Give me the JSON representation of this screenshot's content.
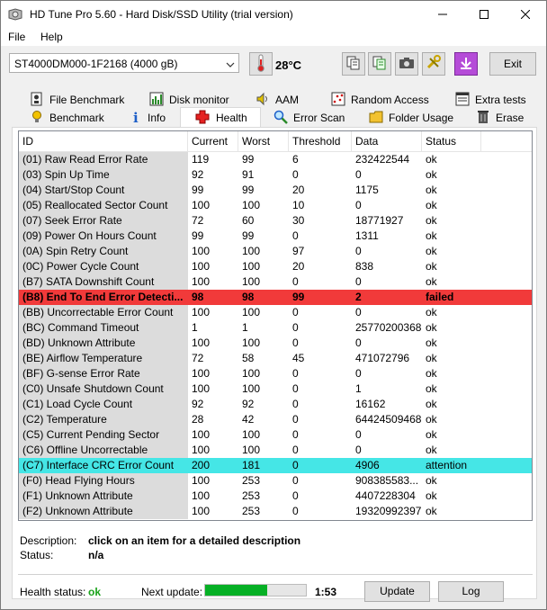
{
  "window": {
    "title": "HD Tune Pro 5.60 - Hard Disk/SSD Utility (trial version)"
  },
  "menu": {
    "file": "File",
    "help": "Help"
  },
  "toolbar": {
    "drive": "ST4000DM000-1F2168 (4000 gB)",
    "temperature": "28°C",
    "exit_label": "Exit"
  },
  "tabs_top": [
    {
      "label": "File Benchmark"
    },
    {
      "label": "Disk monitor"
    },
    {
      "label": "AAM"
    },
    {
      "label": "Random Access"
    },
    {
      "label": "Extra tests"
    }
  ],
  "tabs_bottom": [
    {
      "label": "Benchmark"
    },
    {
      "label": "Info"
    },
    {
      "label": "Health"
    },
    {
      "label": "Error Scan"
    },
    {
      "label": "Folder Usage"
    },
    {
      "label": "Erase"
    }
  ],
  "table": {
    "headers": [
      "ID",
      "Current",
      "Worst",
      "Threshold",
      "Data",
      "Status"
    ],
    "rows": [
      [
        "(01) Raw Read Error Rate",
        "119",
        "99",
        "6",
        "232422544",
        "ok"
      ],
      [
        "(03) Spin Up Time",
        "92",
        "91",
        "0",
        "0",
        "ok"
      ],
      [
        "(04) Start/Stop Count",
        "99",
        "99",
        "20",
        "1175",
        "ok"
      ],
      [
        "(05) Reallocated Sector Count",
        "100",
        "100",
        "10",
        "0",
        "ok"
      ],
      [
        "(07) Seek Error Rate",
        "72",
        "60",
        "30",
        "18771927",
        "ok"
      ],
      [
        "(09) Power On Hours Count",
        "99",
        "99",
        "0",
        "1311",
        "ok"
      ],
      [
        "(0A) Spin Retry Count",
        "100",
        "100",
        "97",
        "0",
        "ok"
      ],
      [
        "(0C) Power Cycle Count",
        "100",
        "100",
        "20",
        "838",
        "ok"
      ],
      [
        "(B7) SATA Downshift Count",
        "100",
        "100",
        "0",
        "0",
        "ok"
      ],
      [
        "(B8) End To End Error Detecti...",
        "98",
        "98",
        "99",
        "2",
        "failed"
      ],
      [
        "(BB) Uncorrectable Error Count",
        "100",
        "100",
        "0",
        "0",
        "ok"
      ],
      [
        "(BC) Command Timeout",
        "1",
        "1",
        "0",
        "25770200368",
        "ok"
      ],
      [
        "(BD) Unknown Attribute",
        "100",
        "100",
        "0",
        "0",
        "ok"
      ],
      [
        "(BE) Airflow Temperature",
        "72",
        "58",
        "45",
        "471072796",
        "ok"
      ],
      [
        "(BF) G-sense Error Rate",
        "100",
        "100",
        "0",
        "0",
        "ok"
      ],
      [
        "(C0) Unsafe Shutdown Count",
        "100",
        "100",
        "0",
        "1",
        "ok"
      ],
      [
        "(C1) Load Cycle Count",
        "92",
        "92",
        "0",
        "16162",
        "ok"
      ],
      [
        "(C2) Temperature",
        "28",
        "42",
        "0",
        "64424509468",
        "ok"
      ],
      [
        "(C5) Current Pending Sector",
        "100",
        "100",
        "0",
        "0",
        "ok"
      ],
      [
        "(C6) Offline Uncorrectable",
        "100",
        "100",
        "0",
        "0",
        "ok"
      ],
      [
        "(C7) Interface CRC Error Count",
        "200",
        "181",
        "0",
        "4906",
        "attention"
      ],
      [
        "(F0) Head Flying Hours",
        "100",
        "253",
        "0",
        "908385583...",
        "ok"
      ],
      [
        "(F1) Unknown Attribute",
        "100",
        "253",
        "0",
        "4407228304",
        "ok"
      ],
      [
        "(F2) Unknown Attribute",
        "100",
        "253",
        "0",
        "19320992397",
        "ok"
      ]
    ]
  },
  "description": {
    "desc_label": "Description:",
    "desc_value": "click on an item for a detailed description",
    "status_label": "Status:",
    "status_value": "n/a"
  },
  "footer": {
    "health_label": "Health status:",
    "health_value": "ok",
    "next_update_label": "Next update:",
    "progress_fraction": 0.62,
    "countdown": "1:53",
    "update_label": "Update",
    "log_label": "Log"
  },
  "colors": {
    "failed_row": "#f13a3a",
    "attention_row": "#45e6e6",
    "ok_text": "#1aa31a",
    "progress": "#06b025"
  }
}
